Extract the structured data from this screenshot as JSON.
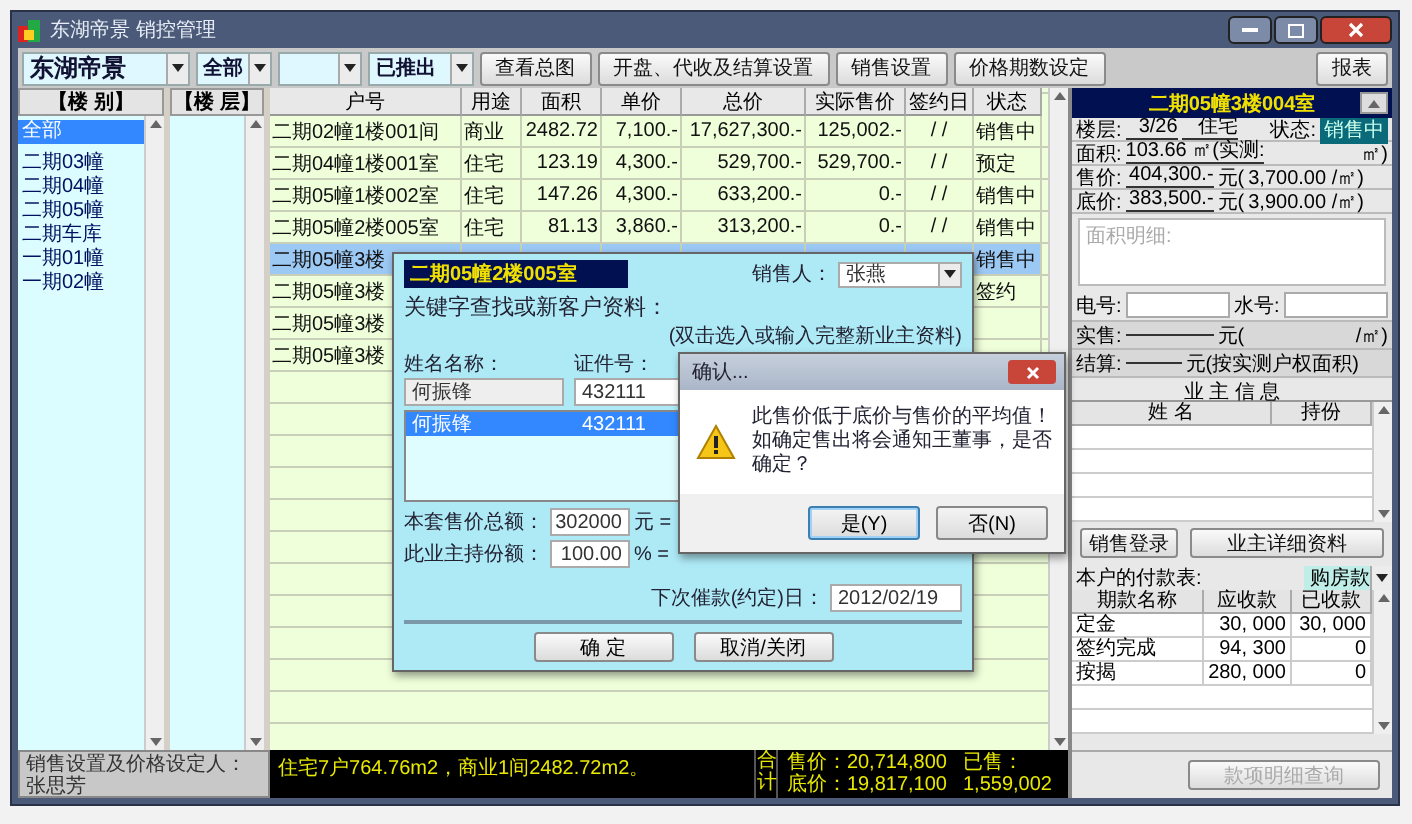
{
  "window": {
    "title": "东湖帝景 销控管理"
  },
  "toolbar": {
    "project": "东湖帝景",
    "scope": "全部",
    "release": "已推出",
    "buttons": [
      "查看总图",
      "开盘、代收及结算设置",
      "销售设置",
      "价格期数设定"
    ],
    "report_button": "报表"
  },
  "building_list": {
    "header": "【楼 别】",
    "items": [
      {
        "label": "全部",
        "selected": true
      },
      {
        "label": "二期03幢",
        "selected": false
      },
      {
        "label": "二期04幢",
        "selected": false
      },
      {
        "label": "二期05幢",
        "selected": false
      },
      {
        "label": "二期车库",
        "selected": false
      },
      {
        "label": "一期01幢",
        "selected": false
      },
      {
        "label": "一期02幢",
        "selected": false
      }
    ]
  },
  "floor_list": {
    "header": "【楼 层】"
  },
  "table": {
    "columns": [
      "户号",
      "用途",
      "面积",
      "单价",
      "总价",
      "实际售价",
      "签约日",
      "状态"
    ],
    "rows": [
      {
        "selected": false,
        "cells": [
          "二期02幢1楼001间",
          "商业",
          "2482.72",
          "7,100.-",
          "17,627,300.-",
          "125,002.-",
          "/ /",
          "销售中"
        ]
      },
      {
        "selected": false,
        "cells": [
          "二期04幢1楼001室",
          "住宅",
          "123.19",
          "4,300.-",
          "529,700.-",
          "529,700.-",
          "/ /",
          "预定"
        ]
      },
      {
        "selected": false,
        "cells": [
          "二期05幢1楼002室",
          "住宅",
          "147.26",
          "4,300.-",
          "633,200.-",
          "0.-",
          "/ /",
          "销售中"
        ]
      },
      {
        "selected": false,
        "cells": [
          "二期05幢2楼005室",
          "住宅",
          "81.13",
          "3,860.-",
          "313,200.-",
          "0.-",
          "/ /",
          "销售中"
        ]
      },
      {
        "selected": true,
        "cells": [
          "二期05幢3楼",
          null,
          null,
          null,
          null,
          null,
          null,
          "销售中"
        ]
      },
      {
        "selected": false,
        "cells": [
          "二期05幢3楼",
          null,
          null,
          null,
          null,
          null,
          null,
          "签约"
        ]
      },
      {
        "selected": false,
        "cells": [
          "二期05幢3楼",
          null,
          null,
          null,
          null,
          null,
          null,
          null
        ]
      },
      {
        "selected": false,
        "cells": [
          "二期05幢3楼",
          null,
          null,
          null,
          null,
          null,
          null,
          null
        ]
      }
    ]
  },
  "status_bar": {
    "setter": "销售设置及价格设定人：张思芳",
    "summary": "住宅7户764.76m2，商业1间2482.72m2。",
    "total_label": "合计",
    "list_price": "售价：20,714,800",
    "floor_price": "底价：19,817,100",
    "sold_label": "已售：",
    "sold_amount": "1,559,002"
  },
  "unit_panel": {
    "title": "二期05幢3楼004室",
    "floor": {
      "label": "楼层:",
      "value": "3/26",
      "use": "住宅",
      "status_label": "状态:",
      "status": "销售中"
    },
    "area": {
      "label": "面积:",
      "value": "103.66 ㎡(实测:",
      "unit": "㎡)"
    },
    "price": {
      "label": "售价:",
      "value": "404,300.-",
      "unit": "元(",
      "per_unit": "3,700.00 /㎡)"
    },
    "base_price": {
      "label": "底价:",
      "value": "383,500.-",
      "unit": "元(",
      "per_unit": "3,900.00 /㎡)"
    },
    "area_details": {
      "placeholder": "面积明细:"
    },
    "meters": [
      {
        "label": "电号:"
      },
      {
        "label": "水号:"
      }
    ],
    "actual": {
      "label": "实售:",
      "unit": "元(",
      "per_unit": "/㎡)"
    },
    "settle": {
      "label": "结算:",
      "unit": "元(按实测户权面积)"
    },
    "owners": {
      "title": "业 主 信 息",
      "columns": [
        "姓 名",
        "持份"
      ]
    },
    "buttons": [
      "销售登录",
      "业主详细资料"
    ],
    "payments": {
      "label": "本户的付款表:",
      "plan": "购房款",
      "columns": [
        "期款名称",
        "应收款",
        "已收款"
      ],
      "rows": [
        [
          "定金",
          "30, 000",
          "30, 000"
        ],
        [
          "签约完成",
          "94, 300",
          "0"
        ],
        [
          "按揭",
          "280, 000",
          "0"
        ]
      ]
    },
    "query_button": {
      "label": "款项明细查询",
      "disabled": true
    }
  },
  "customer_dialog": {
    "title": "二期05幢2楼005室",
    "salesperson_label": "销售人：",
    "salesperson": "张燕",
    "search_label": "关键字查找或新客户资料：",
    "hint": "(双击选入或输入完整新业主资料)",
    "name_label": "姓名名称：",
    "name": "何振锋",
    "id_label": "证件号：",
    "id_value": "432111",
    "results": [
      {
        "name": "何振锋",
        "id": "432111",
        "selected": true
      }
    ],
    "total_label": "本套售价总额：",
    "total": "302000",
    "total_unit": "元 =",
    "share_label": "此业主持份额：",
    "share": "100.00",
    "share_unit": "% =",
    "due_label": "下次催款(约定)日：",
    "due": "2012/02/19",
    "buttons": [
      "确 定",
      "取消/关闭"
    ]
  },
  "confirm_dialog": {
    "title": "确认...",
    "message": [
      "此售价低于底价与售价的平均值！",
      "如确定售出将会通知王董事，是否确定？"
    ],
    "buttons": [
      {
        "label": "是(Y)",
        "focused": true
      },
      {
        "label": "否(N)",
        "focused": false
      }
    ]
  }
}
